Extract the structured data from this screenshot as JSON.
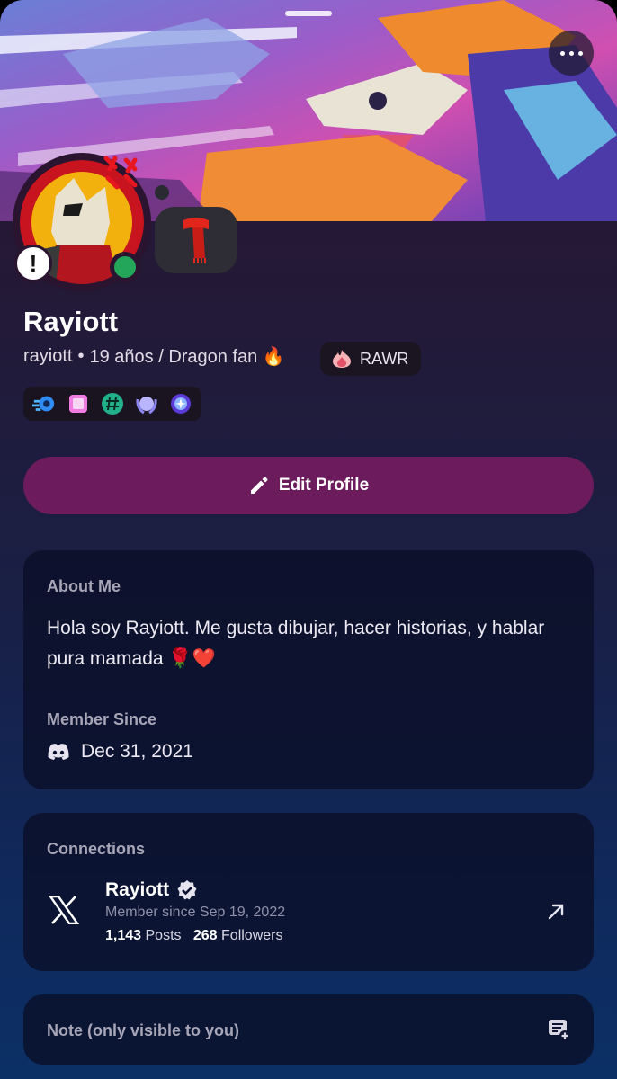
{
  "profile": {
    "display_name": "Rayiott",
    "username": "rayiott",
    "separator": "•",
    "bio_status": "19 años / Dragon fan 🔥",
    "clan_tag": "RAWR",
    "status_emoji": "🧣",
    "online_status_color": "#23a55a"
  },
  "badges": [
    "nitro-icon",
    "hypesquad-icon",
    "hashtag-icon",
    "laurel-icon",
    "quest-icon"
  ],
  "actions": {
    "edit_profile_label": "Edit Profile"
  },
  "about": {
    "title": "About Me",
    "text": "Hola soy Rayiott. Me gusta dibujar, hacer historias, y hablar pura mamada 🌹❤️"
  },
  "member_since": {
    "title": "Member Since",
    "date": "Dec 31, 2021"
  },
  "connections": {
    "title": "Connections",
    "items": [
      {
        "name": "Rayiott",
        "member_since": "Member since Sep 19, 2022",
        "posts_count": "1,143",
        "posts_label": "Posts",
        "followers_count": "268",
        "followers_label": "Followers"
      }
    ]
  },
  "note": {
    "placeholder": "Note (only visible to you)"
  },
  "colors": {
    "accent_button": "#6c1c5c",
    "card_bg": "#0a0e26",
    "online": "#23a55a"
  }
}
